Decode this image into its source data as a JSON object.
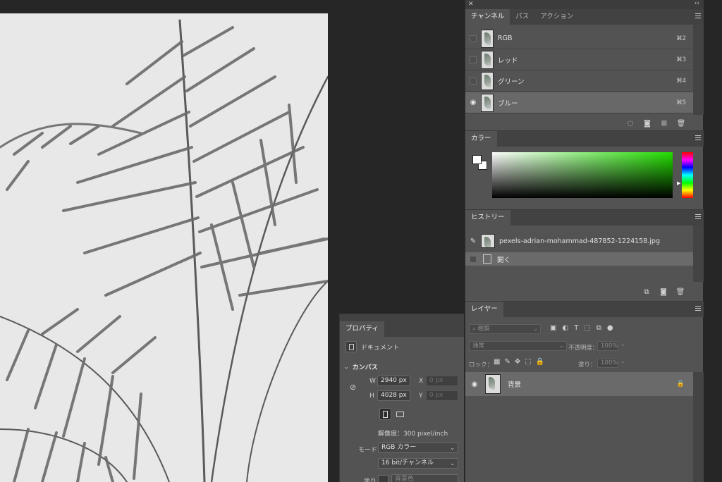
{
  "channels_panel": {
    "tabs": [
      "チャンネル",
      "パス",
      "アクション"
    ],
    "rows": [
      {
        "name": "RGB",
        "shortcut": "⌘2",
        "visible": false
      },
      {
        "name": "レッド",
        "shortcut": "⌘3",
        "visible": false
      },
      {
        "name": "グリーン",
        "shortcut": "⌘4",
        "visible": false
      },
      {
        "name": "ブルー",
        "shortcut": "⌘5",
        "visible": true
      }
    ],
    "footer_icons": [
      "dotted-circle-icon",
      "save-selection-icon",
      "new-channel-icon",
      "trash-icon"
    ]
  },
  "color_panel": {
    "tab": "カラー",
    "foreground": "#ffffff",
    "background": "#ffffff",
    "gradient_hue": "#22dd00"
  },
  "history_panel": {
    "tab": "ヒストリー",
    "snapshot_name": "pexels-adrian-mohammad-487852-1224158.jpg",
    "steps": [
      "開く"
    ],
    "footer_icons": [
      "new-document-from-state-icon",
      "camera-icon",
      "trash-icon"
    ]
  },
  "layers_panel": {
    "tab": "レイヤー",
    "filter_placeholder": "種類",
    "blend_mode": "通常",
    "opacity_label": "不透明度：",
    "opacity_value": "100%",
    "lock_label": "ロック：",
    "fill_label": "塗り：",
    "fill_value": "100%",
    "layers": [
      {
        "name": "背景",
        "locked": true,
        "visible": true
      }
    ]
  },
  "properties_panel": {
    "tab": "プロパティ",
    "section": "ドキュメント",
    "canvas_label": "カンバス",
    "w_label": "W",
    "w_value": "2940 px",
    "h_label": "H",
    "h_value": "4028 px",
    "x_label": "X",
    "x_value": "0 px",
    "y_label": "Y",
    "y_value": "0 px",
    "resolution": "解像度：300 pixel/inch",
    "mode_label": "モード",
    "mode_value": "RGB カラー",
    "depth_value": "16 bit/チャンネル",
    "fill_label": "塗り",
    "fill_value": "背景色"
  }
}
